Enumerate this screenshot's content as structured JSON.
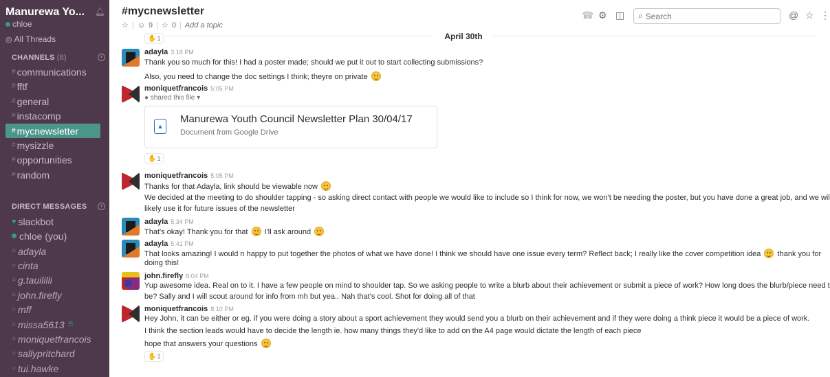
{
  "sidebar": {
    "team_name": "Manurewa Yo...",
    "user_name": "chloe",
    "all_threads": "All Threads",
    "channels_header": "CHANNELS",
    "channels_count": "(8)",
    "channels": [
      {
        "name": "communications"
      },
      {
        "name": "fftf"
      },
      {
        "name": "general"
      },
      {
        "name": "instacomp"
      },
      {
        "name": "mycnewsletter"
      },
      {
        "name": "mysizzle"
      },
      {
        "name": "opportunities"
      },
      {
        "name": "random"
      }
    ],
    "dm_header": "DIRECT MESSAGES",
    "direct_messages": [
      {
        "name": "slackbot"
      },
      {
        "name": "chloe (you)"
      },
      {
        "name": "adayla"
      },
      {
        "name": "cinta"
      },
      {
        "name": "g.tauililli"
      },
      {
        "name": "john.firefly"
      },
      {
        "name": "mff"
      },
      {
        "name": "missa5613"
      },
      {
        "name": "moniquetfrancois"
      },
      {
        "name": "sallypritchard"
      },
      {
        "name": "tui.hawke"
      }
    ],
    "colors": {
      "background": "#4d394b",
      "active": "#4c9689",
      "online": "#38978d"
    }
  },
  "header": {
    "channel_title": "#mycnewsletter",
    "members": "9",
    "pins": "0",
    "topic": "Add a topic",
    "search_placeholder": "Search"
  },
  "messages": {
    "day_label": "April 30th",
    "top_reaction": "1",
    "items": [
      {
        "author": "adayla",
        "time": "3:18 PM",
        "lines": [
          "Thank you so much for this! I had a poster made; should we put it out to start collecting submissions?",
          "Also, you need to change the doc settings I think; theyre on private"
        ]
      },
      {
        "author": "moniquetfrancois",
        "time": "5:05 PM",
        "shared": "shared this file",
        "file_title": "Manurewa Youth Council Newsletter Plan 30/04/17",
        "file_sub": "Document from Google Drive",
        "reaction": "1"
      },
      {
        "author": "moniquetfrancois",
        "time": "5:05 PM",
        "lines": [
          "Thanks for that Adayla, link should be viewable now",
          "We decided at the meeting to do shoulder tapping - so asking direct contact with people we would like to include so I think for now, we won't be needing the poster, but you have done a great job, and we will",
          "likely use it for future issues of the newsletter"
        ]
      },
      {
        "author": "adayla",
        "time": "5:34 PM",
        "lines": [
          "That's okay! Thank you for that",
          "I'll ask around"
        ]
      },
      {
        "author": "adayla",
        "time": "5:41 PM",
        "lines": [
          "That looks amazing! I would n happy to put together the photos of what we have done! I think we should have one issue every term? Reflect back; I really like the cover competition idea",
          "thank you for",
          "doing this!"
        ]
      },
      {
        "author": "john.firefly",
        "time": "6:04 PM",
        "lines": [
          "Yup awesome idea. Real on to it. I have a few people on mind to shoulder tap. So we asking people to write a blurb about their achievement or submit a piece of work? How long does the blurb/piece need to",
          "be? Sally and I will scout around for info from mh but yea.. Nah that's cool. Shot for doing all of that"
        ]
      },
      {
        "author": "moniquetfrancois",
        "time": "8:10 PM",
        "lines": [
          "Hey John, it can be either or eg. if you were doing a story about a sport achievement they would send you a blurb on their achievement  and if they were doing a think piece it would be a piece of work.",
          "I think the section leads would have to decide the length ie. how many things they'd like to add on the A4 page would dictate the length of each piece",
          "hope that answers your questions"
        ],
        "reaction": "1"
      }
    ]
  }
}
